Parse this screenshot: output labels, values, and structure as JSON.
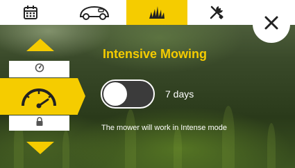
{
  "app": {
    "tabs": [
      {
        "icon": "calendar-icon",
        "active": false
      },
      {
        "icon": "mower-icon",
        "active": false
      },
      {
        "icon": "grass-icon",
        "active": true
      },
      {
        "icon": "tools-icon",
        "active": false
      }
    ],
    "close_icon": "close-icon"
  },
  "mode_selector": {
    "up_icon": "arrow-up-icon",
    "down_icon": "arrow-down-icon",
    "previous_mode_icon": "timer-icon",
    "selected_mode_icon": "speedometer-icon",
    "next_mode_icon": "lock-icon"
  },
  "main": {
    "title": "Intensive Mowing",
    "toggle_on": false,
    "duration": "7 days",
    "description": "The mower will work in Intense mode"
  },
  "colors": {
    "accent": "#f5cc00",
    "bar": "#ffffff",
    "toggle_track": "#3b3b3b",
    "text": "#ffffff"
  }
}
